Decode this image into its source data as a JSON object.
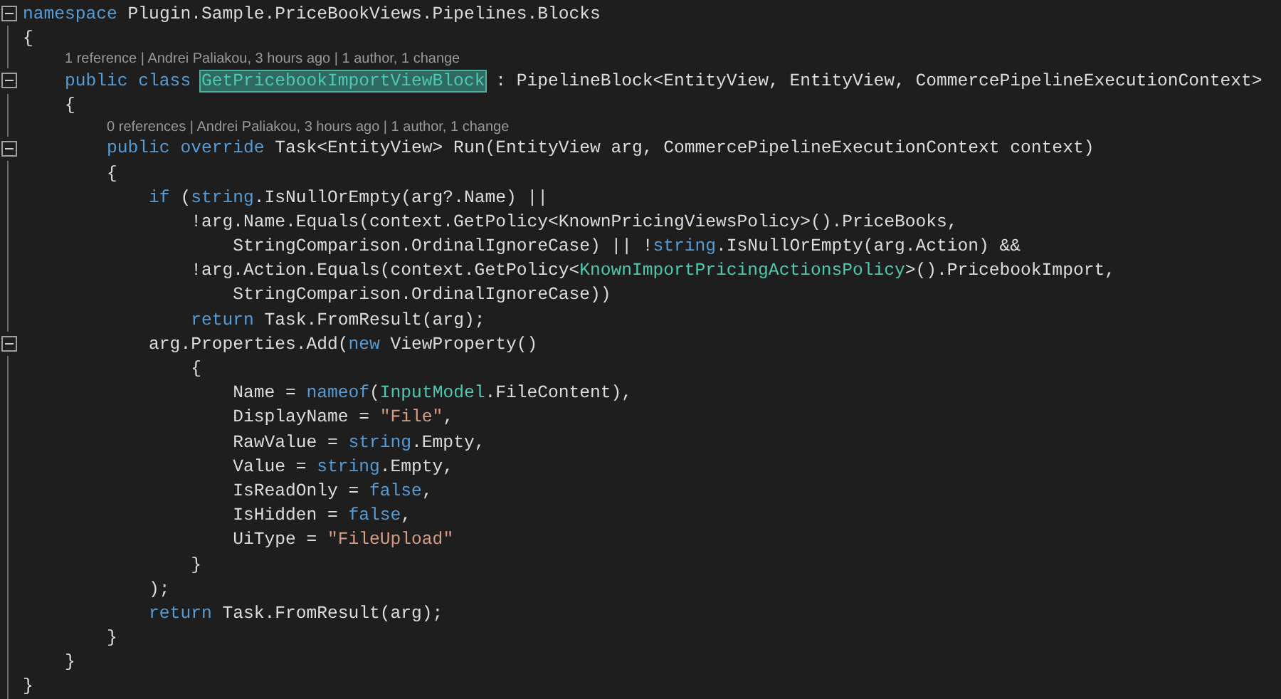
{
  "editor": {
    "lines": [
      {
        "kind": "code",
        "expanded": true,
        "tokens": [
          {
            "kind": "keyword",
            "text": "namespace"
          },
          {
            "kind": "plain",
            "text": " Plugin.Sample.PriceBookViews.Pipelines.Blocks"
          }
        ]
      },
      {
        "kind": "code",
        "tokens": [
          {
            "kind": "plain",
            "text": "{"
          }
        ]
      },
      {
        "kind": "lens",
        "text": "1 reference | Andrei Paliakou, 3 hours ago | 1 author, 1 change"
      },
      {
        "kind": "code",
        "expanded": true,
        "tokens": [
          {
            "kind": "keyword",
            "text": "    public class "
          },
          {
            "kind": "highlight",
            "text": "GetPricebookImportViewBlock"
          },
          {
            "kind": "plain",
            "text": " : PipelineBlock<EntityView, EntityView, CommercePipelineExecutionContext>"
          }
        ]
      },
      {
        "kind": "code",
        "tokens": [
          {
            "kind": "plain",
            "text": "    {"
          }
        ]
      },
      {
        "kind": "lens",
        "text": "0 references | Andrei Paliakou, 3 hours ago | 1 author, 1 change"
      },
      {
        "kind": "code",
        "expanded": true,
        "tokens": [
          {
            "kind": "keyword",
            "text": "        public override"
          },
          {
            "kind": "plain",
            "text": " Task<EntityView> Run(EntityView arg, CommercePipelineExecutionContext context)"
          }
        ]
      },
      {
        "kind": "code",
        "tokens": [
          {
            "kind": "plain",
            "text": "        {"
          }
        ]
      },
      {
        "kind": "code",
        "tokens": [
          {
            "kind": "keyword",
            "text": "            if"
          },
          {
            "kind": "plain",
            "text": " ("
          },
          {
            "kind": "keyword",
            "text": "string"
          },
          {
            "kind": "plain",
            "text": ".IsNullOrEmpty(arg?.Name) ||"
          }
        ]
      },
      {
        "kind": "code",
        "tokens": [
          {
            "kind": "plain",
            "text": "                !arg.Name.Equals(context.GetPolicy<KnownPricingViewsPolicy>().PriceBooks,"
          }
        ]
      },
      {
        "kind": "code",
        "tokens": [
          {
            "kind": "plain",
            "text": "                    StringComparison.OrdinalIgnoreCase) || !"
          },
          {
            "kind": "keyword",
            "text": "string"
          },
          {
            "kind": "plain",
            "text": ".IsNullOrEmpty(arg.Action) &&"
          }
        ]
      },
      {
        "kind": "code",
        "tokens": [
          {
            "kind": "plain",
            "text": "                !arg.Action.Equals(context.GetPolicy<"
          },
          {
            "kind": "type",
            "text": "KnownImportPricingActionsPolicy"
          },
          {
            "kind": "plain",
            "text": ">().PricebookImport,"
          }
        ]
      },
      {
        "kind": "code",
        "tokens": [
          {
            "kind": "plain",
            "text": "                    StringComparison.OrdinalIgnoreCase))"
          }
        ]
      },
      {
        "kind": "code",
        "tokens": [
          {
            "kind": "keyword",
            "text": "                return"
          },
          {
            "kind": "plain",
            "text": " Task.FromResult(arg);"
          }
        ]
      },
      {
        "kind": "code",
        "expanded": true,
        "tokens": [
          {
            "kind": "plain",
            "text": "            arg.Properties.Add("
          },
          {
            "kind": "keyword",
            "text": "new"
          },
          {
            "kind": "plain",
            "text": " ViewProperty()"
          }
        ]
      },
      {
        "kind": "code",
        "tokens": [
          {
            "kind": "plain",
            "text": "                {"
          }
        ]
      },
      {
        "kind": "code",
        "tokens": [
          {
            "kind": "plain",
            "text": "                    Name = "
          },
          {
            "kind": "keyword",
            "text": "nameof"
          },
          {
            "kind": "plain",
            "text": "("
          },
          {
            "kind": "type",
            "text": "InputModel"
          },
          {
            "kind": "plain",
            "text": ".FileContent),"
          }
        ]
      },
      {
        "kind": "code",
        "tokens": [
          {
            "kind": "plain",
            "text": "                    DisplayName = "
          },
          {
            "kind": "string",
            "text": "\"File\""
          },
          {
            "kind": "plain",
            "text": ","
          }
        ]
      },
      {
        "kind": "code",
        "tokens": [
          {
            "kind": "plain",
            "text": "                    RawValue = "
          },
          {
            "kind": "keyword",
            "text": "string"
          },
          {
            "kind": "plain",
            "text": ".Empty,"
          }
        ]
      },
      {
        "kind": "code",
        "tokens": [
          {
            "kind": "plain",
            "text": "                    Value = "
          },
          {
            "kind": "keyword",
            "text": "string"
          },
          {
            "kind": "plain",
            "text": ".Empty,"
          }
        ]
      },
      {
        "kind": "code",
        "tokens": [
          {
            "kind": "plain",
            "text": "                    IsReadOnly = "
          },
          {
            "kind": "keyword",
            "text": "false"
          },
          {
            "kind": "plain",
            "text": ","
          }
        ]
      },
      {
        "kind": "code",
        "tokens": [
          {
            "kind": "plain",
            "text": "                    IsHidden = "
          },
          {
            "kind": "keyword",
            "text": "false"
          },
          {
            "kind": "plain",
            "text": ","
          }
        ]
      },
      {
        "kind": "code",
        "tokens": [
          {
            "kind": "plain",
            "text": "                    UiType = "
          },
          {
            "kind": "string",
            "text": "\"FileUpload\""
          }
        ]
      },
      {
        "kind": "code",
        "tokens": [
          {
            "kind": "plain",
            "text": "                }"
          }
        ]
      },
      {
        "kind": "code",
        "tokens": [
          {
            "kind": "plain",
            "text": "            );"
          }
        ]
      },
      {
        "kind": "code",
        "tokens": [
          {
            "kind": "keyword",
            "text": "            return"
          },
          {
            "kind": "plain",
            "text": " Task.FromResult(arg);"
          }
        ]
      },
      {
        "kind": "code",
        "tokens": [
          {
            "kind": "plain",
            "text": "        }"
          }
        ]
      },
      {
        "kind": "code",
        "tokens": [
          {
            "kind": "plain",
            "text": "    }"
          }
        ]
      },
      {
        "kind": "code",
        "tokens": [
          {
            "kind": "plain",
            "text": "}"
          }
        ]
      }
    ]
  }
}
